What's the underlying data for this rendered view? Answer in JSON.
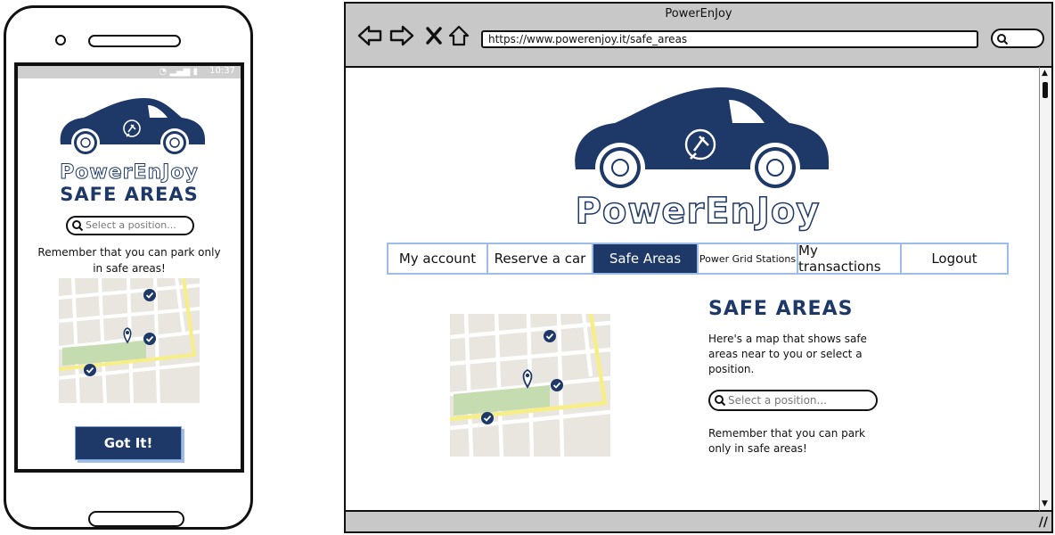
{
  "mobile": {
    "status_time": "10:37",
    "brand": "PowerEnJoy",
    "title": "SAFE AREAS",
    "search_placeholder": "Select a position...",
    "remember_text": "Remember that you can park only in safe areas!",
    "got_it_label": "Got It!"
  },
  "browser": {
    "window_title": "PowerEnJoy",
    "url": "https://www.powerenjoy.it/safe_areas",
    "brand": "PowerEnJoy",
    "menu": [
      {
        "label": "My account"
      },
      {
        "label": "Reserve a car"
      },
      {
        "label": "Safe Areas"
      },
      {
        "label": "Power Grid Stations"
      },
      {
        "label": "My transactions"
      },
      {
        "label": "Logout"
      }
    ],
    "active_menu": "Safe Areas",
    "title": "SAFE AREAS",
    "description": "Here's a map that shows safe areas near to you or select a position.",
    "search_placeholder": "Select a position...",
    "remember_text": "Remember that you can park only in safe areas!"
  },
  "colors": {
    "brand_navy": "#1e3868",
    "menu_border": "#9dbde8",
    "map_bg": "#e9e6df",
    "map_park": "#c5dbb0",
    "map_main_road": "#f7ef86"
  },
  "icons": [
    "back-arrow-icon",
    "forward-arrow-icon",
    "close-x-icon",
    "home-icon",
    "search-icon",
    "check-marker-icon",
    "map-pin-icon",
    "car-logo-icon",
    "plug-icon",
    "wifi-icon"
  ]
}
